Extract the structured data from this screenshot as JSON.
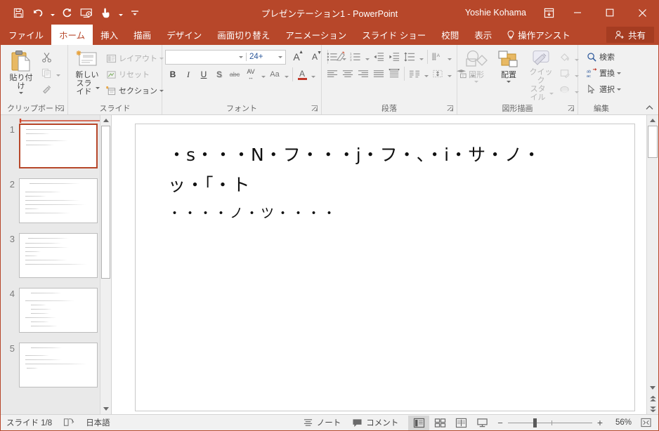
{
  "titlebar": {
    "document_title": "プレゼンテーション1 - PowerPoint",
    "account_name": "Yoshie Kohama",
    "qat": [
      {
        "name": "save",
        "icon": "save-icon"
      },
      {
        "name": "undo",
        "icon": "undo-icon"
      },
      {
        "name": "redo",
        "icon": "redo-icon"
      },
      {
        "name": "start-from-beginning",
        "icon": "slideshow-icon"
      },
      {
        "name": "touch-mouse-mode",
        "icon": "touch-mode-icon"
      },
      {
        "name": "customize-qat",
        "icon": "customize-icon"
      }
    ],
    "ribbon_display_options": "ribbon-display-icon",
    "minimize": "—",
    "maximize": "☐",
    "close": "✕"
  },
  "tabs": [
    {
      "label": "ファイル",
      "active": false
    },
    {
      "label": "ホーム",
      "active": true
    },
    {
      "label": "挿入",
      "active": false
    },
    {
      "label": "描画",
      "active": false
    },
    {
      "label": "デザイン",
      "active": false
    },
    {
      "label": "画面切り替え",
      "active": false
    },
    {
      "label": "アニメーション",
      "active": false
    },
    {
      "label": "スライド ショー",
      "active": false
    },
    {
      "label": "校閲",
      "active": false
    },
    {
      "label": "表示",
      "active": false
    }
  ],
  "tell_me": "操作アシスト",
  "share": "共有",
  "ribbon": {
    "clipboard": {
      "group_label": "クリップボード",
      "paste": "貼り付け",
      "cut": "cut-icon",
      "copy": "copy-icon",
      "format_painter": "format-painter-icon"
    },
    "slides": {
      "group_label": "スライド",
      "new_slide_line1": "新しい",
      "new_slide_line2": "スライド",
      "layout": "レイアウト",
      "reset": "リセット",
      "section": "セクション"
    },
    "font": {
      "group_label": "フォント",
      "font_name": "",
      "font_name_placeholder": "",
      "font_size": "24+",
      "grow_font": "A",
      "shrink_font": "A",
      "clear_formatting": "clear-formatting-icon",
      "bold": "B",
      "italic": "I",
      "underline": "U",
      "shadow": "S",
      "strikethrough": "abc",
      "character_spacing": "AV",
      "change_case": "Aa",
      "font_color": "A"
    },
    "paragraph": {
      "group_label": "段落",
      "bullets": "bullets-icon",
      "numbering": "numbering-icon",
      "decrease_indent": "decrease-indent-icon",
      "increase_indent": "increase-indent-icon",
      "line_spacing": "line-spacing-icon",
      "text_direction": "text-direction-icon",
      "align_left": "align-left-icon",
      "align_center": "align-center-icon",
      "align_right": "align-right-icon",
      "justify": "justify-icon",
      "columns": "columns-icon",
      "align_text": "align-text-icon",
      "convert_smartart": "smartart-icon"
    },
    "drawing": {
      "group_label": "図形描画",
      "shapes": "図形",
      "arrange": "配置",
      "quick_styles_line1": "クイック",
      "quick_styles_line2": "スタイル",
      "shape_fill": "shape-fill-icon",
      "shape_outline": "shape-outline-icon",
      "shape_effects": "shape-effects-icon"
    },
    "editing": {
      "group_label": "編集",
      "find": "検索",
      "replace": "置換",
      "select": "選択"
    },
    "collapse": "collapse-ribbon-icon"
  },
  "thumbnails": [
    {
      "number": "1",
      "selected": true,
      "lines": [
        [
          8,
          6,
          88
        ],
        [
          8,
          12,
          34
        ],
        [
          8,
          22,
          60
        ],
        [
          8,
          28,
          40
        ]
      ]
    },
    {
      "number": "2",
      "selected": false,
      "lines": [
        [
          14,
          6,
          72
        ],
        [
          8,
          18,
          52
        ],
        [
          8,
          24,
          30
        ],
        [
          8,
          30,
          78
        ],
        [
          8,
          36,
          86
        ],
        [
          8,
          42,
          20
        ],
        [
          8,
          48,
          64
        ]
      ]
    },
    {
      "number": "3",
      "selected": false,
      "lines": [
        [
          12,
          6,
          58
        ],
        [
          8,
          13,
          52
        ],
        [
          8,
          19,
          62
        ],
        [
          8,
          25,
          22
        ],
        [
          8,
          31,
          18
        ],
        [
          8,
          37,
          60
        ],
        [
          8,
          43,
          88
        ]
      ]
    },
    {
      "number": "4",
      "selected": false,
      "lines": [
        [
          16,
          6,
          44
        ],
        [
          8,
          17,
          70
        ],
        [
          16,
          23,
          22
        ],
        [
          16,
          29,
          30
        ],
        [
          16,
          35,
          26
        ],
        [
          8,
          41,
          44
        ],
        [
          16,
          47,
          26
        ],
        [
          16,
          53,
          38
        ]
      ]
    },
    {
      "number": "5",
      "selected": false,
      "lines": [
        [
          16,
          6,
          44
        ],
        [
          8,
          17,
          34
        ],
        [
          8,
          23,
          52
        ],
        [
          8,
          29,
          88
        ],
        [
          10,
          35,
          16
        ]
      ]
    }
  ],
  "slide": {
    "line1": "・s・・・N・フ・・・j・フ・、・i・サ・ノ・",
    "line2": "ッ・「・ト",
    "bullets": "・・・・ノ・ツ・・・・"
  },
  "statusbar": {
    "slide_counter": "スライド 1/8",
    "accessibility": "accessibility-icon",
    "language": "日本語",
    "notes": "ノート",
    "comments": "コメント",
    "views": [
      {
        "name": "normal-view",
        "active": true
      },
      {
        "name": "slide-sorter-view",
        "active": false
      },
      {
        "name": "reading-view",
        "active": false
      },
      {
        "name": "slideshow-view",
        "active": false
      }
    ],
    "zoom_out": "−",
    "zoom_in": "+",
    "zoom_level": "56%",
    "fit_to_window": "fit-to-window-icon"
  },
  "colors": {
    "accent": "#b7472a",
    "accent_dark": "#a53c21",
    "ribbon_bg": "#f1f1f1",
    "thumbpane_bg": "#e9e9e9",
    "font_size_text": "#2b579a"
  }
}
